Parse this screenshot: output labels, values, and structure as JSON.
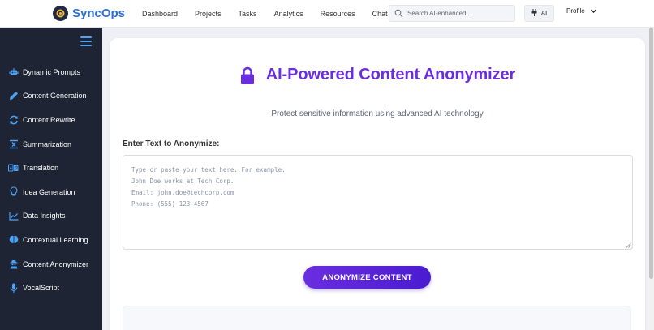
{
  "brand": {
    "name": "SyncOps"
  },
  "nav": [
    "Dashboard",
    "Projects",
    "Tasks",
    "Analytics",
    "Resources",
    "Chat"
  ],
  "search": {
    "placeholder": "Search AI-enhanced..."
  },
  "ai_button": {
    "label": "AI"
  },
  "profile": {
    "label": "Profile"
  },
  "sidebar": {
    "items": [
      {
        "label": "Dynamic Prompts",
        "icon": "robot-icon"
      },
      {
        "label": "Content Generation",
        "icon": "pen-icon"
      },
      {
        "label": "Content Rewrite",
        "icon": "sync-icon"
      },
      {
        "label": "Summarization",
        "icon": "compress-icon"
      },
      {
        "label": "Translation",
        "icon": "language-icon"
      },
      {
        "label": "Idea Generation",
        "icon": "lightbulb-icon"
      },
      {
        "label": "Data Insights",
        "icon": "chart-line-icon"
      },
      {
        "label": "Contextual Learning",
        "icon": "brain-icon"
      },
      {
        "label": "Content Anonymizer",
        "icon": "user-secret-icon"
      },
      {
        "label": "VocalScript",
        "icon": "microphone-icon"
      }
    ]
  },
  "main": {
    "title": "AI-Powered Content Anonymizer",
    "subtitle": "Protect sensitive information using advanced AI technology",
    "field_label": "Enter Text to Anonymize:",
    "textarea_placeholder": "Type or paste your text here. For example:\nJohn Doe works at Tech Corp.\nEmail: john.doe@techcorp.com\nPhone: (555) 123-4567",
    "button_label": "ANONYMIZE CONTENT"
  },
  "colors": {
    "accent": "#6a2ee0",
    "brand": "#2a6fd6",
    "sidebar_bg": "#1e2433",
    "sidebar_icon": "#4ea3f5"
  }
}
